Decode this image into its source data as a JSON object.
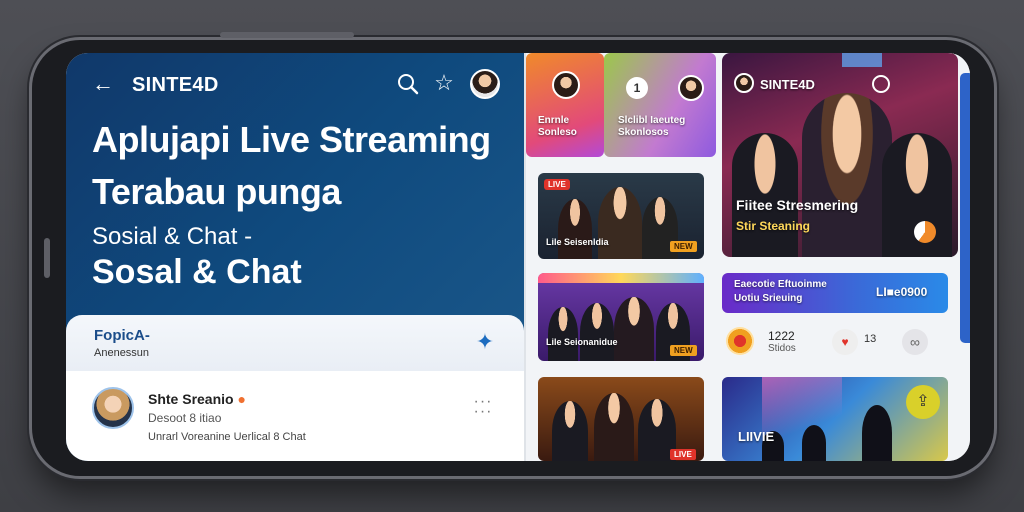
{
  "header": {
    "app_title": "SINTE4D",
    "back_icon": "arrow-left-icon",
    "search_icon": "search-icon",
    "star_icon": "star-icon"
  },
  "hero": {
    "line1": "Aplujapi Live Streaming",
    "line2": "Terabau punga",
    "subtitle": "Sosial & Chat -",
    "line3": "Sosal & Chat"
  },
  "promo": {
    "title": "FopicA-",
    "subtitle": "Anenessun",
    "icon": "sparkle-icon"
  },
  "post": {
    "name": "Shte Sreanio",
    "meta": "Desoot  8  itiao",
    "description": "Unrarl Voreanine Uerlical 8 Chat"
  },
  "tiles": {
    "top_left": {
      "line1": "Enrnle",
      "line2": "Sonleso"
    },
    "top_mid": {
      "line1": "Slclibl Iaeuteg",
      "line2": "Skonlosos"
    },
    "top_right": {
      "title": "SINTE4D"
    },
    "card1": {
      "badge": "LIVE",
      "caption": "Lile Seisenldia",
      "tag": "NEW"
    },
    "card2": {
      "caption": "Lile Seionanidue",
      "tag": "NEW"
    },
    "card3": {
      "tag": "LIVE"
    },
    "featured": {
      "title": "Fiitee Stresmering",
      "subtitle": "Stir Steaning"
    },
    "banner": {
      "line1": "Eaecotie Eftuoinme",
      "line2": "Uotiu Srieuing",
      "counter": "LI■e0900"
    },
    "stats": {
      "count": "1222",
      "count_label": "Stidos",
      "likes": "13"
    },
    "concert": {
      "caption": "LIIVIE"
    }
  },
  "colors": {
    "header_blue": "#10386a",
    "accent_blue": "#2d63c8",
    "live_red": "#e0332a",
    "fab_yellow": "#d9d02a"
  }
}
